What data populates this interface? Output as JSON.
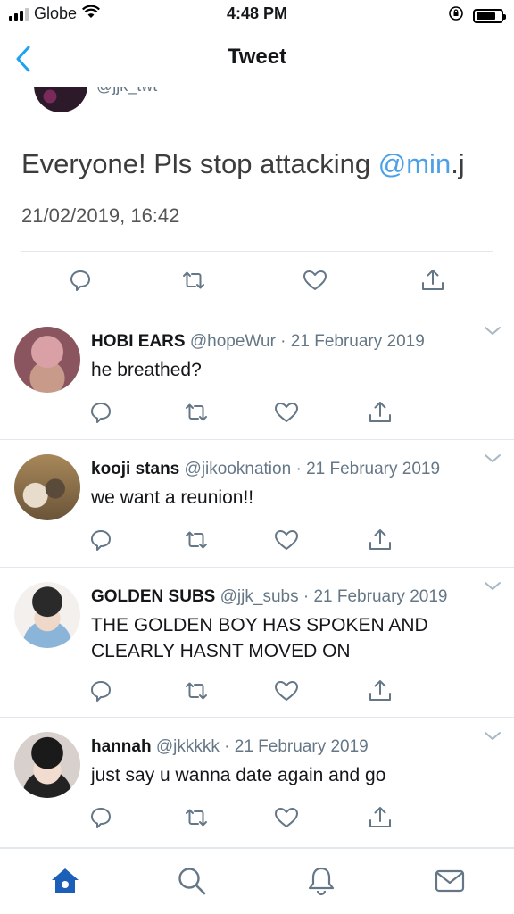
{
  "status_bar": {
    "carrier": "Globe",
    "time": "4:48 PM"
  },
  "nav": {
    "title": "Tweet"
  },
  "main_tweet": {
    "handle": "@jjk_twt",
    "text": "Everyone! Pls stop attacking ",
    "mention": "@min",
    "text_after": ".j",
    "date": "21/02/2019, 16:42"
  },
  "replies": [
    {
      "name": "HOBI EARS",
      "handle": "@hopeWur",
      "date": "21 February 2019",
      "text": "he breathed?"
    },
    {
      "name": "kooji stans",
      "handle": "@jikooknation",
      "date": "21 February 2019",
      "text": "we want a reunion!!"
    },
    {
      "name": "GOLDEN SUBS",
      "handle": "@jjk_subs",
      "date": "21 February 2019",
      "text": "THE GOLDEN BOY HAS SPOKEN AND CLEARLY HASNT MOVED ON"
    },
    {
      "name": "hannah",
      "handle": "@jkkkkk",
      "date": "21 February 2019",
      "text": "just say u wanna date again and go"
    }
  ],
  "separator": " · ",
  "colors": {
    "accent": "#1da1f2",
    "mention": "#4ba0e8",
    "home_active": "#1b5fb8",
    "icon_gray": "#657786"
  },
  "tab_bar": {
    "items": [
      "home-icon",
      "search-icon",
      "notifications-icon",
      "messages-icon"
    ]
  }
}
